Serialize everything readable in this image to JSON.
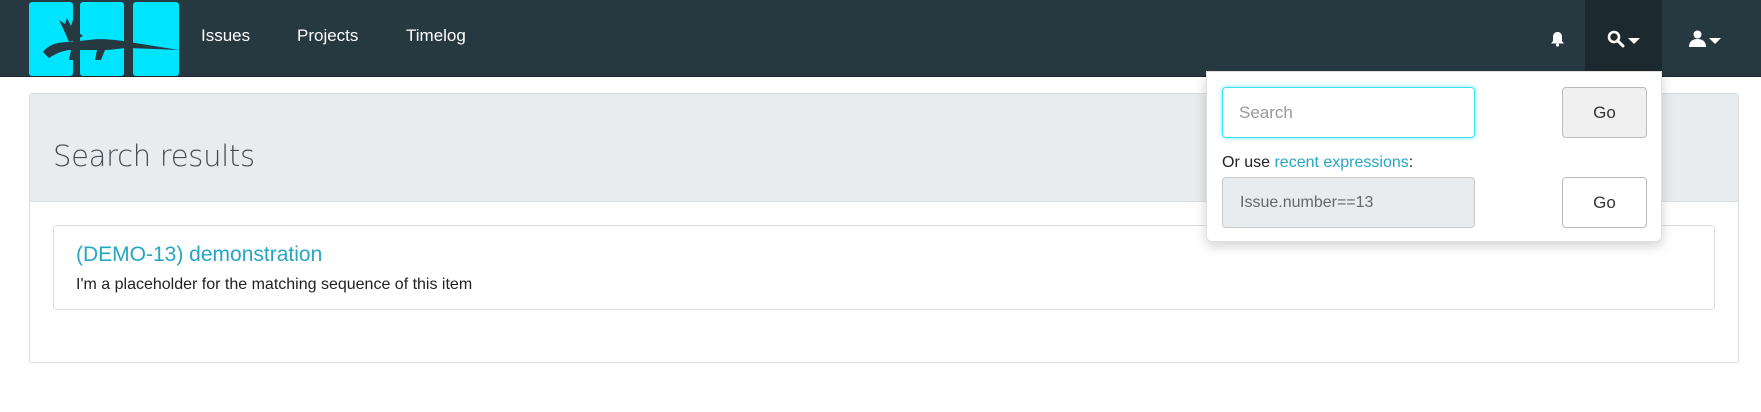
{
  "nav": {
    "items": [
      {
        "label": "Issues"
      },
      {
        "label": "Projects"
      },
      {
        "label": "Timelog"
      }
    ],
    "icons": {
      "notifications": "bell-icon",
      "search": "search-icon",
      "user": "user-icon"
    }
  },
  "colors": {
    "navbar": "#263840",
    "logo_tile": "#00e5ff",
    "link": "#26a6c2"
  },
  "page": {
    "title": "Search results"
  },
  "results": [
    {
      "title": "(DEMO-13) demonstration",
      "snippet": "I'm a placeholder for the matching sequence of this item"
    }
  ],
  "search_dropdown": {
    "search_placeholder": "Search",
    "search_value": "",
    "go_label": "Go",
    "or_use_prefix": "Or use ",
    "recent_link": "recent expressions",
    "or_use_suffix": ":",
    "expression_value": "Issue.number==13",
    "go_label_2": "Go"
  }
}
